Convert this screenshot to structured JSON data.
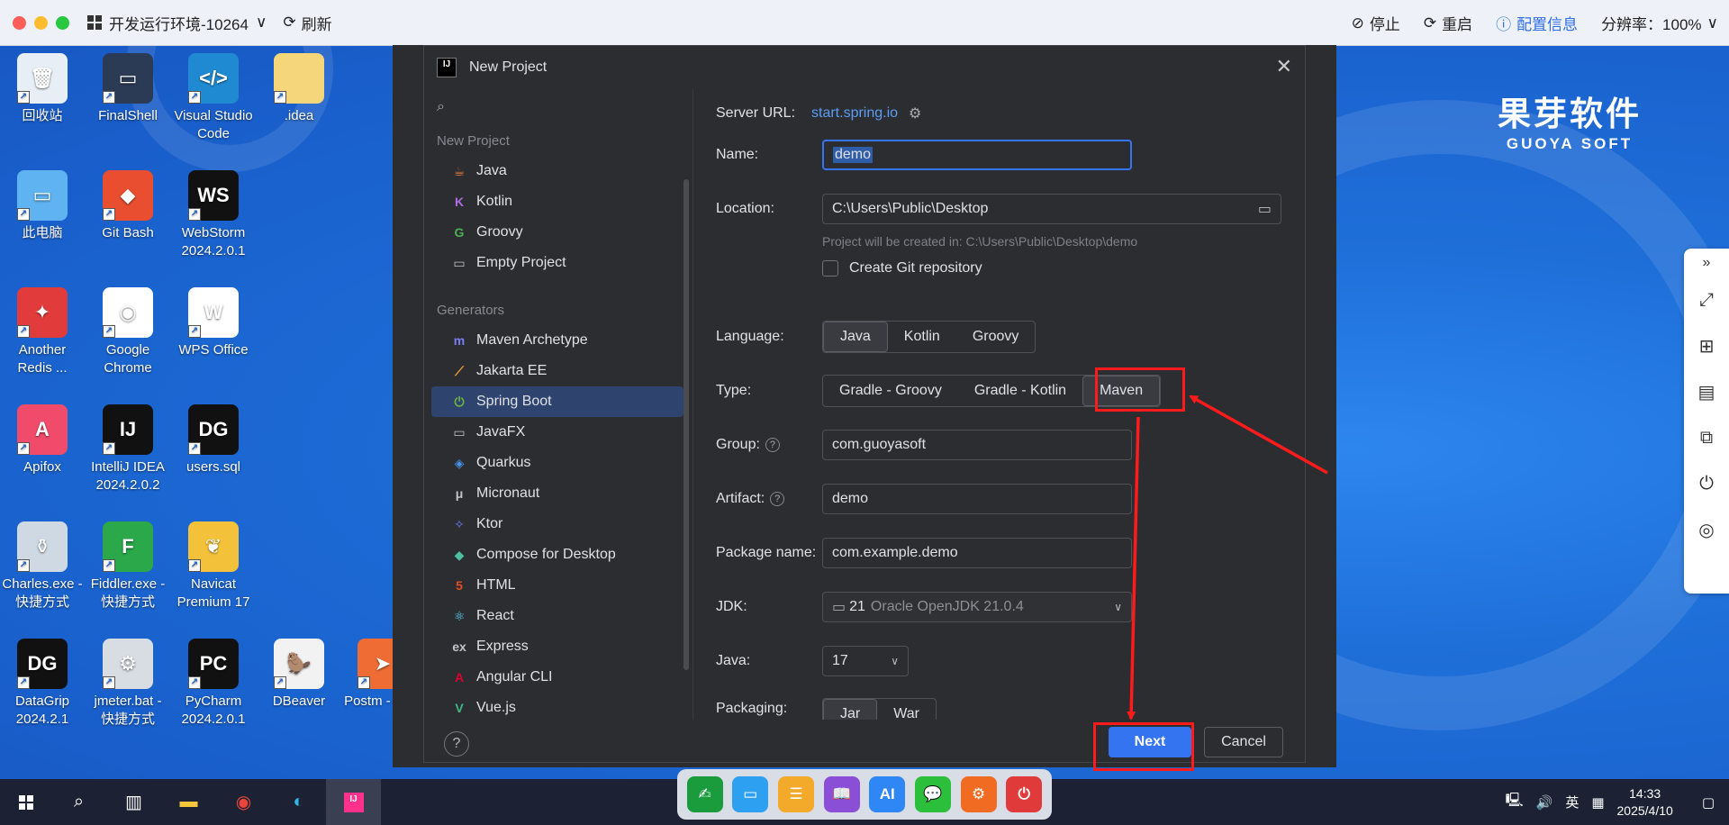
{
  "topbar": {
    "env": "开发运行环境-10264",
    "refresh": "刷新",
    "stop": "停止",
    "restart": "重启",
    "config": "配置信息",
    "resolution": "分辨率：100%"
  },
  "desktop_icons": [
    {
      "label": "回收站",
      "color": "#e8eef6",
      "text": "🗑"
    },
    {
      "label": "FinalShell",
      "color": "#2b3a55",
      "text": "▭"
    },
    {
      "label": "Visual Studio Code",
      "color": "#1f8ad2",
      "text": "</>"
    },
    {
      "label": ".idea",
      "color": "#f6d67a",
      "text": ""
    },
    {
      "label": "此电脑",
      "color": "#5fb3f0",
      "text": "▭"
    },
    {
      "label": "Git Bash",
      "color": "#e94e31",
      "text": "◆"
    },
    {
      "label": "WebStorm 2024.2.0.1",
      "color": "#111",
      "text": "WS"
    },
    {
      "label": "Another Redis ...",
      "color": "#e23b3b",
      "text": "✦"
    },
    {
      "label": "Google Chrome",
      "color": "#ffffff",
      "text": "◉"
    },
    {
      "label": "WPS Office",
      "color": "#ffffff",
      "text": "W"
    },
    {
      "label": "Apifox",
      "color": "#f04b6a",
      "text": "A"
    },
    {
      "label": "IntelliJ IDEA 2024.2.0.2",
      "color": "#111",
      "text": "IJ"
    },
    {
      "label": "users.sql",
      "color": "#111",
      "text": "DG"
    },
    {
      "label": "Charles.exe - 快捷方式",
      "color": "#cfd9e4",
      "text": "⚱"
    },
    {
      "label": "Fiddler.exe - 快捷方式",
      "color": "#2aa84a",
      "text": "F"
    },
    {
      "label": "Navicat Premium 17",
      "color": "#f3c23a",
      "text": "❦"
    },
    {
      "label": "DataGrip 2024.2.1",
      "color": "#111",
      "text": "DG"
    },
    {
      "label": "jmeter.bat - 快捷方式",
      "color": "#d7dde3",
      "text": "⚙"
    },
    {
      "label": "PyCharm 2024.2.0.1",
      "color": "#111",
      "text": "PC"
    },
    {
      "label": "DBeaver",
      "color": "#f2f2f2",
      "text": "🦫"
    },
    {
      "label": "Postm - 快捷",
      "color": "#ef6c35",
      "text": "➤"
    }
  ],
  "brand": {
    "cn": "果芽软件",
    "en": "GUOYA SOFT"
  },
  "dialog": {
    "title": "New Project",
    "title_badge": "IJ",
    "sections": {
      "new_project": "New Project",
      "generators": "Generators"
    },
    "new_project_items": [
      {
        "label": "Java",
        "icon": "cup-icon",
        "color": "#e07a3b",
        "glyph": "☕"
      },
      {
        "label": "Kotlin",
        "icon": "kotlin-icon",
        "color": "#b06be6",
        "glyph": "K"
      },
      {
        "label": "Groovy",
        "icon": "groovy-icon",
        "color": "#4caf50",
        "glyph": "G"
      },
      {
        "label": "Empty Project",
        "icon": "folder-icon",
        "color": "#c0c4cc",
        "glyph": "▭"
      }
    ],
    "generator_items": [
      {
        "label": "Maven Archetype",
        "icon": "maven-icon",
        "color": "#7b7ff5",
        "glyph": "m"
      },
      {
        "label": "Jakarta EE",
        "icon": "jakarta-icon",
        "color": "#f0a13a",
        "glyph": "⟋"
      },
      {
        "label": "Spring Boot",
        "icon": "spring-icon",
        "color": "#6db33f",
        "glyph": "⏻"
      },
      {
        "label": "JavaFX",
        "icon": "window-icon",
        "color": "#c0c4cc",
        "glyph": "▭"
      },
      {
        "label": "Quarkus",
        "icon": "quarkus-icon",
        "color": "#4695eb",
        "glyph": "◈"
      },
      {
        "label": "Micronaut",
        "icon": "micronaut-icon",
        "color": "#c0c4cc",
        "glyph": "μ"
      },
      {
        "label": "Ktor",
        "icon": "ktor-icon",
        "color": "#6c7bf5",
        "glyph": "✧"
      },
      {
        "label": "Compose for Desktop",
        "icon": "compose-icon",
        "color": "#4bc0a0",
        "glyph": "◆"
      },
      {
        "label": "HTML",
        "icon": "html-icon",
        "color": "#e44d26",
        "glyph": "5"
      },
      {
        "label": "React",
        "icon": "react-icon",
        "color": "#61dafb",
        "glyph": "⚛"
      },
      {
        "label": "Express",
        "icon": "express-icon",
        "color": "#c0c4cc",
        "glyph": "ex"
      },
      {
        "label": "Angular CLI",
        "icon": "angular-icon",
        "color": "#dd0031",
        "glyph": "A"
      },
      {
        "label": "Vue.js",
        "icon": "vue-icon",
        "color": "#41b883",
        "glyph": "V"
      }
    ],
    "selected_generator": "Spring Boot",
    "form": {
      "server_url_label": "Server URL:",
      "server_url": "start.spring.io",
      "name_label": "Name:",
      "name": "demo",
      "location_label": "Location:",
      "location": "C:\\Users\\Public\\Desktop",
      "location_hint": "Project will be created in: C:\\Users\\Public\\Desktop\\demo",
      "git_label": "Create Git repository",
      "language_label": "Language:",
      "languages": [
        "Java",
        "Kotlin",
        "Groovy"
      ],
      "language_selected": "Java",
      "type_label": "Type:",
      "types": [
        "Gradle - Groovy",
        "Gradle - Kotlin",
        "Maven"
      ],
      "type_selected": "Maven",
      "group_label": "Group:",
      "group": "com.guoyasoft",
      "artifact_label": "Artifact:",
      "artifact": "demo",
      "package_label": "Package name:",
      "package": "com.example.demo",
      "jdk_label": "JDK:",
      "jdk_version": "21",
      "jdk_name": "Oracle OpenJDK 21.0.4",
      "java_label": "Java:",
      "java": "17",
      "packaging_label": "Packaging:",
      "packagings": [
        "Jar",
        "War"
      ]
    },
    "buttons": {
      "next": "Next",
      "cancel": "Cancel"
    },
    "help": "?"
  },
  "taskbar": {
    "time": "14:33",
    "date": "2025/4/10",
    "ime": "英",
    "dock_icons": [
      {
        "name": "sign-icon",
        "color": "#1a9b3c",
        "glyph": "✍"
      },
      {
        "name": "monitor-icon",
        "color": "#2ea0f2",
        "glyph": "▭"
      },
      {
        "name": "server-icon",
        "color": "#f3a92a",
        "glyph": "☰"
      },
      {
        "name": "book-icon",
        "color": "#8a4fd6",
        "glyph": "📖"
      },
      {
        "name": "ai-icon",
        "color": "#2f86f5",
        "glyph": "AI"
      },
      {
        "name": "chat-icon",
        "color": "#2cbf3c",
        "glyph": "💬"
      },
      {
        "name": "settings-icon",
        "color": "#f26b22",
        "glyph": "⚙"
      },
      {
        "name": "power-icon",
        "color": "#e03a3a",
        "glyph": "⏻"
      }
    ]
  }
}
